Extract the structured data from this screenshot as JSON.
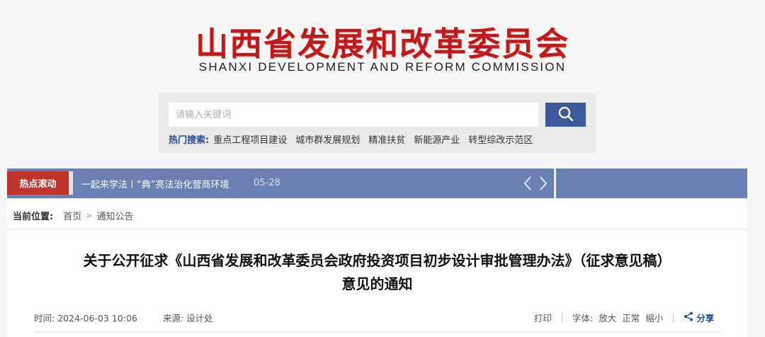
{
  "header": {
    "title_cn": "山西省发展和改革委员会",
    "title_en": "SHANXI DEVELOPMENT AND REFORM COMMISSION"
  },
  "search": {
    "placeholder": "请输入关键词",
    "button_icon": "search-icon",
    "hot_label": "热门搜索:",
    "hot_terms": [
      "重点工程项目建设",
      "城市群发展规划",
      "精准扶贫",
      "新能源产业",
      "转型综改示范区"
    ]
  },
  "ticker": {
    "label": "热点滚动",
    "text": "一起来学法丨“典”亮法治化营商环境",
    "date": "05-28",
    "prev_icon": "chevron-left-icon",
    "next_icon": "chevron-right-icon"
  },
  "breadcrumb": {
    "label": "当前位置:",
    "items": [
      "首页",
      "通知公告"
    ],
    "separator": ">"
  },
  "article": {
    "title_line1": "关于公开征求《山西省发展和改革委员会政府投资项目初步设计审批管理办法》（征求意见稿）",
    "title_line2": "意见的通知",
    "time_label": "时间:",
    "time_value": "2024-06-03 10:06",
    "source_label": "来源:",
    "source_value": "设计处",
    "print": "打印",
    "font_label": "字体:",
    "font_large": "放大",
    "font_normal": "正常",
    "font_small": "缩小",
    "share": "分享",
    "share_icon": "share-icon"
  },
  "colors": {
    "brand_red": "#c11a1a",
    "nav_blue": "#6b80b4",
    "accent_blue": "#3c5a9a",
    "ticker_red": "#c0342b"
  }
}
